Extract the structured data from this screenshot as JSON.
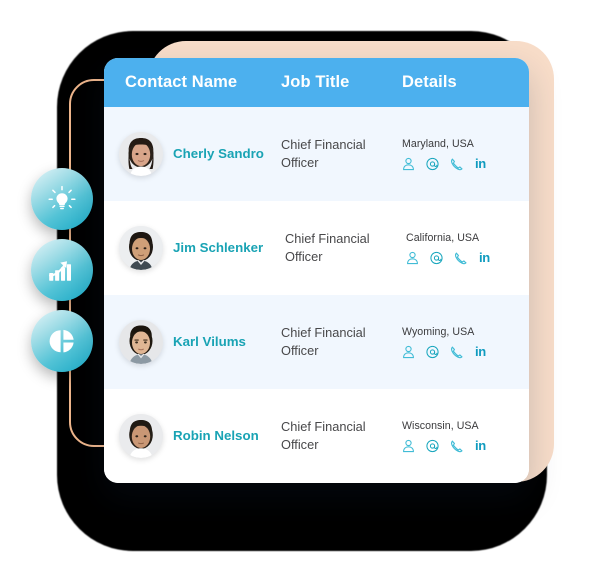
{
  "theme": {
    "header_blue": "#4cb0ee",
    "name_teal": "#19a3b4",
    "row_alt_bg": "#f1f7fe",
    "row_bg": "#ffffff",
    "peach_panel": "#f8ddc9",
    "peach_line": "#edb58b",
    "backdrop_dark": "#000000",
    "badge_gradient_from": "#e8f7fa",
    "badge_gradient_to": "#16a7c4"
  },
  "table": {
    "columns": [
      {
        "key": "contact_name",
        "label": "Contact Name"
      },
      {
        "key": "job_title",
        "label": "Job Title"
      },
      {
        "key": "details",
        "label": "Details"
      }
    ],
    "rows": [
      {
        "contact_name": "Cherly Sandro",
        "job_title": "Chief Financial Officer",
        "location": "Maryland, USA",
        "avatar_alt": "avatar-cherly-sandro",
        "actions": [
          "contact-person-icon",
          "email-icon",
          "phone-icon",
          "linkedin-icon"
        ],
        "linkedin_label": "in"
      },
      {
        "contact_name": "Jim Schlenker",
        "job_title": "Chief Financial Officer",
        "location": "California, USA",
        "avatar_alt": "avatar-jim-schlenker",
        "actions": [
          "contact-person-icon",
          "email-icon",
          "phone-icon",
          "linkedin-icon"
        ],
        "linkedin_label": "in"
      },
      {
        "contact_name": "Karl Vilums",
        "job_title": "Chief Financial Officer",
        "location": "Wyoming, USA",
        "avatar_alt": "avatar-karl-vilums",
        "actions": [
          "contact-person-icon",
          "email-icon",
          "phone-icon",
          "linkedin-icon"
        ],
        "linkedin_label": "in"
      },
      {
        "contact_name": "Robin Nelson",
        "job_title": "Chief Financial Officer",
        "location": "Wisconsin, USA",
        "avatar_alt": "avatar-robin-nelson",
        "actions": [
          "contact-person-icon",
          "email-icon",
          "phone-icon",
          "linkedin-icon"
        ],
        "linkedin_label": "in"
      }
    ]
  },
  "badges": [
    {
      "icon": "lightbulb-icon"
    },
    {
      "icon": "bar-chart-growth-icon"
    },
    {
      "icon": "pie-chart-icon"
    }
  ]
}
